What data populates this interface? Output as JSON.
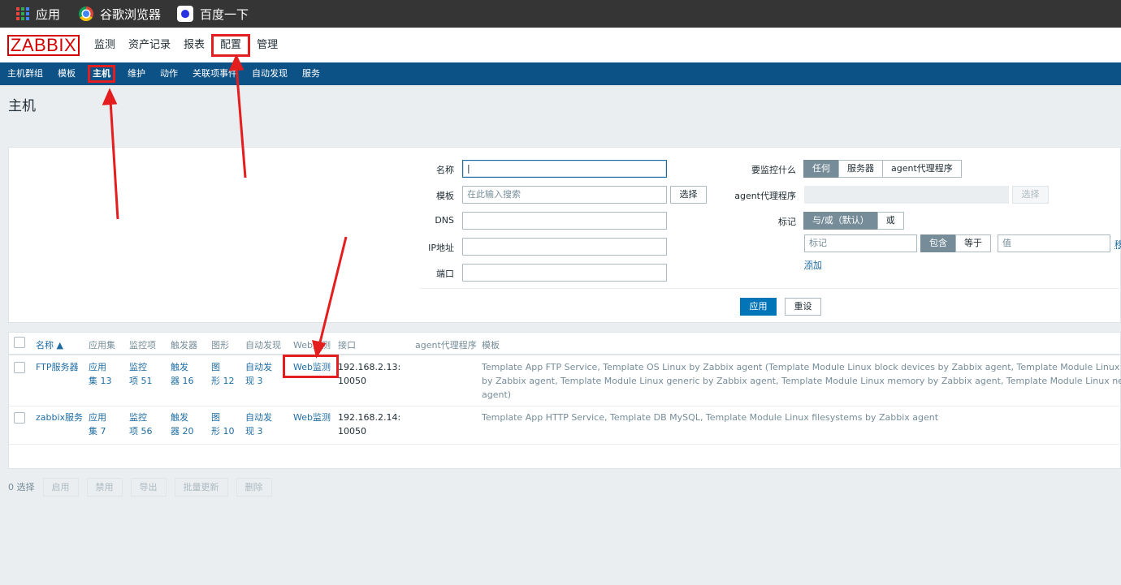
{
  "bookmarks": [
    {
      "label": "应用",
      "icon": "apps-grid-icon"
    },
    {
      "label": "谷歌浏览器",
      "icon": "chrome-icon"
    },
    {
      "label": "百度一下",
      "icon": "baidu-icon"
    }
  ],
  "logo": "ZABBIX",
  "main_menu": [
    "监测",
    "资产记录",
    "报表",
    "配置",
    "管理"
  ],
  "main_menu_selected": "配置",
  "sub_menu": [
    "主机群组",
    "模板",
    "主机",
    "维护",
    "动作",
    "关联项事件",
    "自动发现",
    "服务"
  ],
  "sub_menu_selected": "主机",
  "page_title": "主机",
  "filter": {
    "name_label": "名称",
    "name_value": "|",
    "template_label": "模板",
    "template_placeholder": "在此输入搜索",
    "select_button": "选择",
    "dns_label": "DNS",
    "ip_label": "IP地址",
    "port_label": "端口",
    "monitor_label": "要监控什么",
    "monitor_options": [
      "任何",
      "服务器",
      "agent代理程序"
    ],
    "proxy_label": "agent代理程序",
    "proxy_select_button": "选择",
    "tags_label": "标记",
    "tag_eval_options": [
      "与/或（默认）",
      "或"
    ],
    "tag_placeholder": "标记",
    "tag_operator_options": [
      "包含",
      "等于"
    ],
    "value_placeholder": "值",
    "remove_link": "移",
    "add_link": "添加",
    "apply_button": "应用",
    "reset_button": "重设"
  },
  "table": {
    "columns": [
      "名称 ▲",
      "应用集",
      "监控项",
      "触发器",
      "图形",
      "自动发现",
      "Web监测",
      "接口",
      "agent代理程序",
      "模板"
    ],
    "rows": [
      {
        "name": "FTP服务器",
        "apps": [
          "应用",
          "集 13"
        ],
        "items": [
          "监控",
          "项 51"
        ],
        "triggers": [
          "触发",
          "器 16"
        ],
        "graphs": [
          "图",
          "形 12"
        ],
        "discovery": [
          "自动发",
          "现 3"
        ],
        "web": "Web监测",
        "interface": [
          "192.168.2.13:",
          "10050"
        ],
        "proxy": "",
        "templates": [
          "Template App FTP Service, Template OS Linux by Zabbix agent (Template Module Linux block devices by Zabbix agent, Template Module Linux CPU by Zabbix agent,",
          "by Zabbix agent, Template Module Linux generic by Zabbix agent, Template Module Linux memory by Zabbix agent, Template Module Linux network interfaces",
          "agent)"
        ]
      },
      {
        "name": "zabbix服务",
        "apps": [
          "应用",
          "集 7"
        ],
        "items": [
          "监控",
          "项 56"
        ],
        "triggers": [
          "触发",
          "器 20"
        ],
        "graphs": [
          "图",
          "形 10"
        ],
        "discovery": [
          "自动发",
          "现 3"
        ],
        "web": "Web监测",
        "interface": [
          "192.168.2.14:",
          "10050"
        ],
        "proxy": "",
        "templates": [
          "Template App HTTP Service, Template DB MySQL, Template Module Linux filesystems by Zabbix agent"
        ]
      }
    ]
  },
  "footer": {
    "selected_count": "0 选择",
    "buttons": [
      "启用",
      "禁用",
      "导出",
      "批量更新",
      "删除"
    ]
  },
  "colors": {
    "accent_red": "#e41e1e",
    "nav_blue": "#0d5286",
    "primary_blue": "#0275b8",
    "link_blue": "#1f6da4"
  }
}
